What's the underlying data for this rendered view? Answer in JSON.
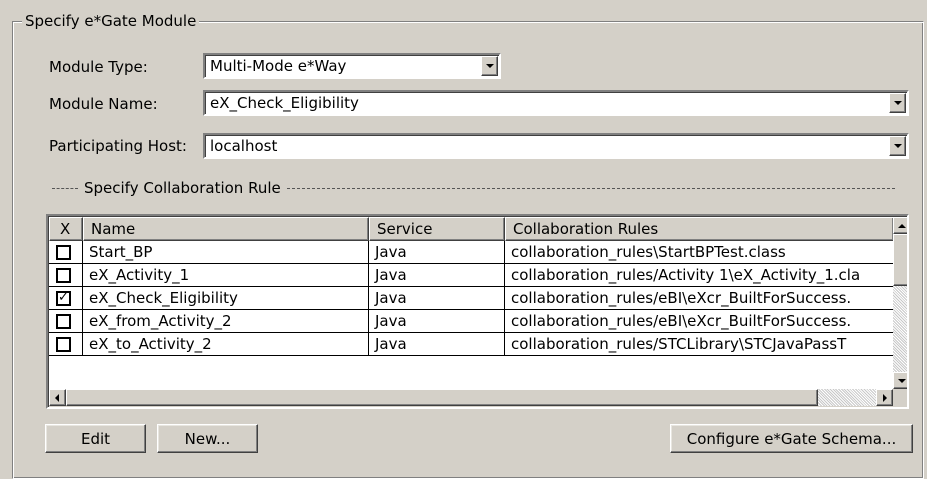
{
  "group": {
    "title": "Specify e*Gate Module"
  },
  "module_type": {
    "label": "Module Type:",
    "value": "Multi-Mode e*Way"
  },
  "module_name": {
    "label": "Module Name:",
    "value": "eX_Check_Eligibility"
  },
  "participating_host": {
    "label": "Participating Host:",
    "value": "localhost"
  },
  "collab_section": {
    "title": "Specify Collaboration Rule"
  },
  "table": {
    "headers": {
      "check": "X",
      "name": "Name",
      "service": "Service",
      "rules": "Collaboration Rules"
    },
    "rows": [
      {
        "checked": false,
        "check_mark": "",
        "name": "Start_BP",
        "service": "Java",
        "rules": "collaboration_rules\\StartBPTest.class"
      },
      {
        "checked": false,
        "check_mark": "",
        "name": "eX_Activity_1",
        "service": "Java",
        "rules": "collaboration_rules/Activity 1\\eX_Activity_1.cla"
      },
      {
        "checked": true,
        "check_mark": "✓",
        "name": "eX_Check_Eligibility",
        "service": "Java",
        "rules": "collaboration_rules/eBI\\eXcr_BuiltForSuccess."
      },
      {
        "checked": false,
        "check_mark": "",
        "name": "eX_from_Activity_2",
        "service": "Java",
        "rules": "collaboration_rules/eBI\\eXcr_BuiltForSuccess."
      },
      {
        "checked": false,
        "check_mark": "",
        "name": "eX_to_Activity_2",
        "service": "Java",
        "rules": "collaboration_rules/STCLibrary\\STCJavaPassT"
      }
    ]
  },
  "buttons": {
    "edit": "Edit",
    "new": "New...",
    "configure": "Configure e*Gate Schema..."
  },
  "colors": {
    "face": "#d4d0c8",
    "window": "#ffffff"
  }
}
